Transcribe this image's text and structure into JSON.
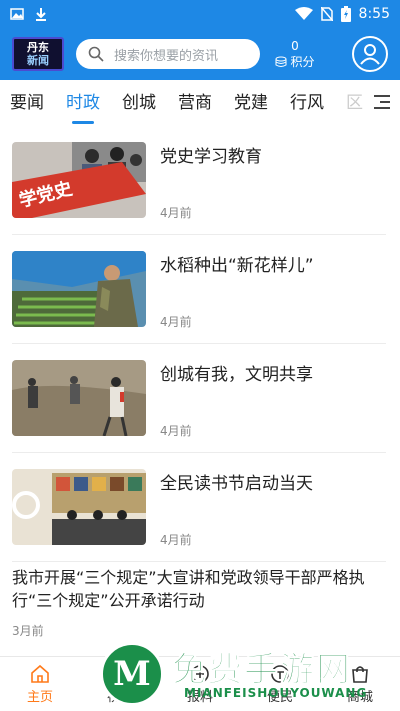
{
  "status_bar": {
    "time": "8:55"
  },
  "header": {
    "logo_line1": "丹东",
    "logo_line2": "新闻",
    "search_placeholder": "搜索你想要的资讯",
    "points_value": "0",
    "points_label": "积分"
  },
  "tabs": [
    {
      "label": "要闻"
    },
    {
      "label": "时政",
      "active": true
    },
    {
      "label": "创城"
    },
    {
      "label": "营商"
    },
    {
      "label": "党建"
    },
    {
      "label": "行风"
    },
    {
      "label": "区"
    }
  ],
  "news": [
    {
      "title": "党史学习教育",
      "time": "4月前",
      "image": "students-red-banner"
    },
    {
      "title": "水稻种出“新花样儿”",
      "time": "4月前",
      "image": "rice-seedling-greenhouse"
    },
    {
      "title": "创城有我，文明共享",
      "time": "4月前",
      "image": "volunteers-cleaning"
    },
    {
      "title": "全民读书节启动当天",
      "time": "4月前",
      "image": "reading-festival-livestream"
    }
  ],
  "text_news": {
    "title": "我市开展“三个规定”大宣讲和党政领导干部严格执行“三个规定”公开承诺行动",
    "time": "3月前"
  },
  "bottom_nav": [
    {
      "label": "主页",
      "icon": "home-icon",
      "active": true
    },
    {
      "label": "视听",
      "icon": "video-icon"
    },
    {
      "label": "报料",
      "icon": "report-icon"
    },
    {
      "label": "便民",
      "icon": "service-icon"
    },
    {
      "label": "商城",
      "icon": "shop-icon"
    }
  ],
  "watermark": {
    "text": "免费手游网",
    "sub": "MIANFEISHOUYOUWANG",
    "logo_letter": "M"
  },
  "colors": {
    "primary": "#1e88e5",
    "active_nav": "#ff7a1a"
  }
}
